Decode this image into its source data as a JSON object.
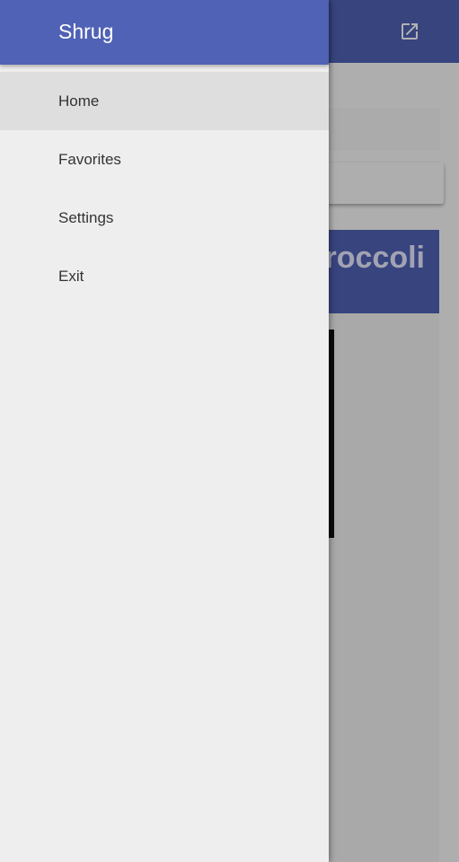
{
  "drawer": {
    "title": "Shrug",
    "items": [
      {
        "label": "Home",
        "active": true
      },
      {
        "label": "Favorites",
        "active": false
      },
      {
        "label": "Settings",
        "active": false
      },
      {
        "label": "Exit",
        "active": false
      }
    ]
  },
  "background": {
    "card_title_fragment": "roccoli"
  },
  "toolbar": {
    "action_icon": "open-in-new-icon"
  },
  "colors": {
    "primary": "#5062b5",
    "drawer_bg": "#eeeeee",
    "active_item_bg": "#dedede",
    "item_text": "#333333"
  }
}
